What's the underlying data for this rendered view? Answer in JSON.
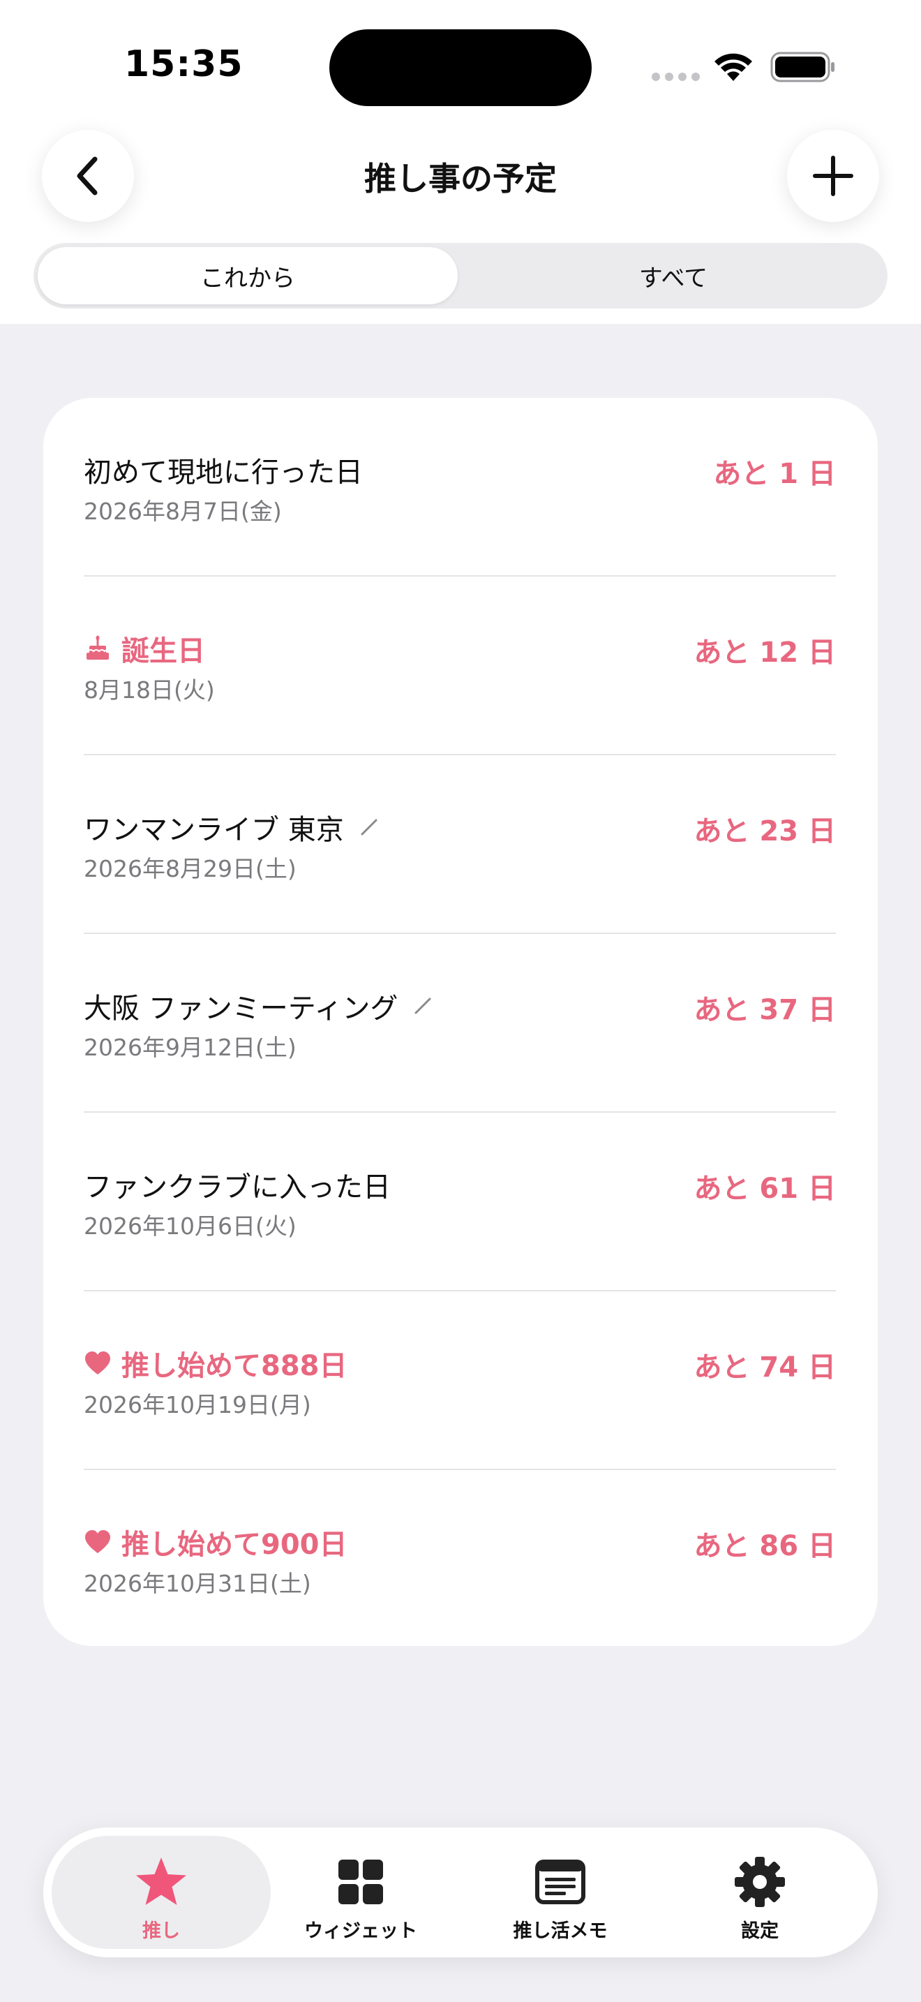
{
  "status_bar": {
    "time": "15:35"
  },
  "header": {
    "title": "推し事の予定"
  },
  "segments": {
    "upcoming": "これから",
    "all": "すべて"
  },
  "events": [
    {
      "title": "初めて現地に行った日",
      "date": "2026年8月7日(金)",
      "countdown": "あと 1 日"
    },
    {
      "title": "誕生日",
      "date": "8月18日(火)",
      "countdown": "あと 12 日",
      "icon": "cake-icon"
    },
    {
      "title": "ワンマンライブ 東京",
      "date": "2026年8月29日(土)",
      "countdown": "あと 23 日",
      "editable": true
    },
    {
      "title": "大阪 ファンミーティング",
      "date": "2026年9月12日(土)",
      "countdown": "あと 37 日",
      "editable": true
    },
    {
      "title": "ファンクラブに入った日",
      "date": "2026年10月6日(火)",
      "countdown": "あと 61 日"
    },
    {
      "title": "推し始めて888日",
      "date": "2026年10月19日(月)",
      "countdown": "あと 74 日",
      "icon": "heart-icon"
    },
    {
      "title": "推し始めて900日",
      "date": "2026年10月31日(土)",
      "countdown": "あと 86 日",
      "icon": "heart-icon"
    }
  ],
  "tab_bar": {
    "items": [
      {
        "label": "推し",
        "icon": "star-icon",
        "active": true
      },
      {
        "label": "ウィジェット",
        "icon": "grid-icon"
      },
      {
        "label": "推し活メモ",
        "icon": "note-icon"
      },
      {
        "label": "設定",
        "icon": "gear-icon"
      }
    ]
  },
  "colors": {
    "accent": "#e8677f",
    "background": "#f0f0f4",
    "card": "#ffffff"
  }
}
